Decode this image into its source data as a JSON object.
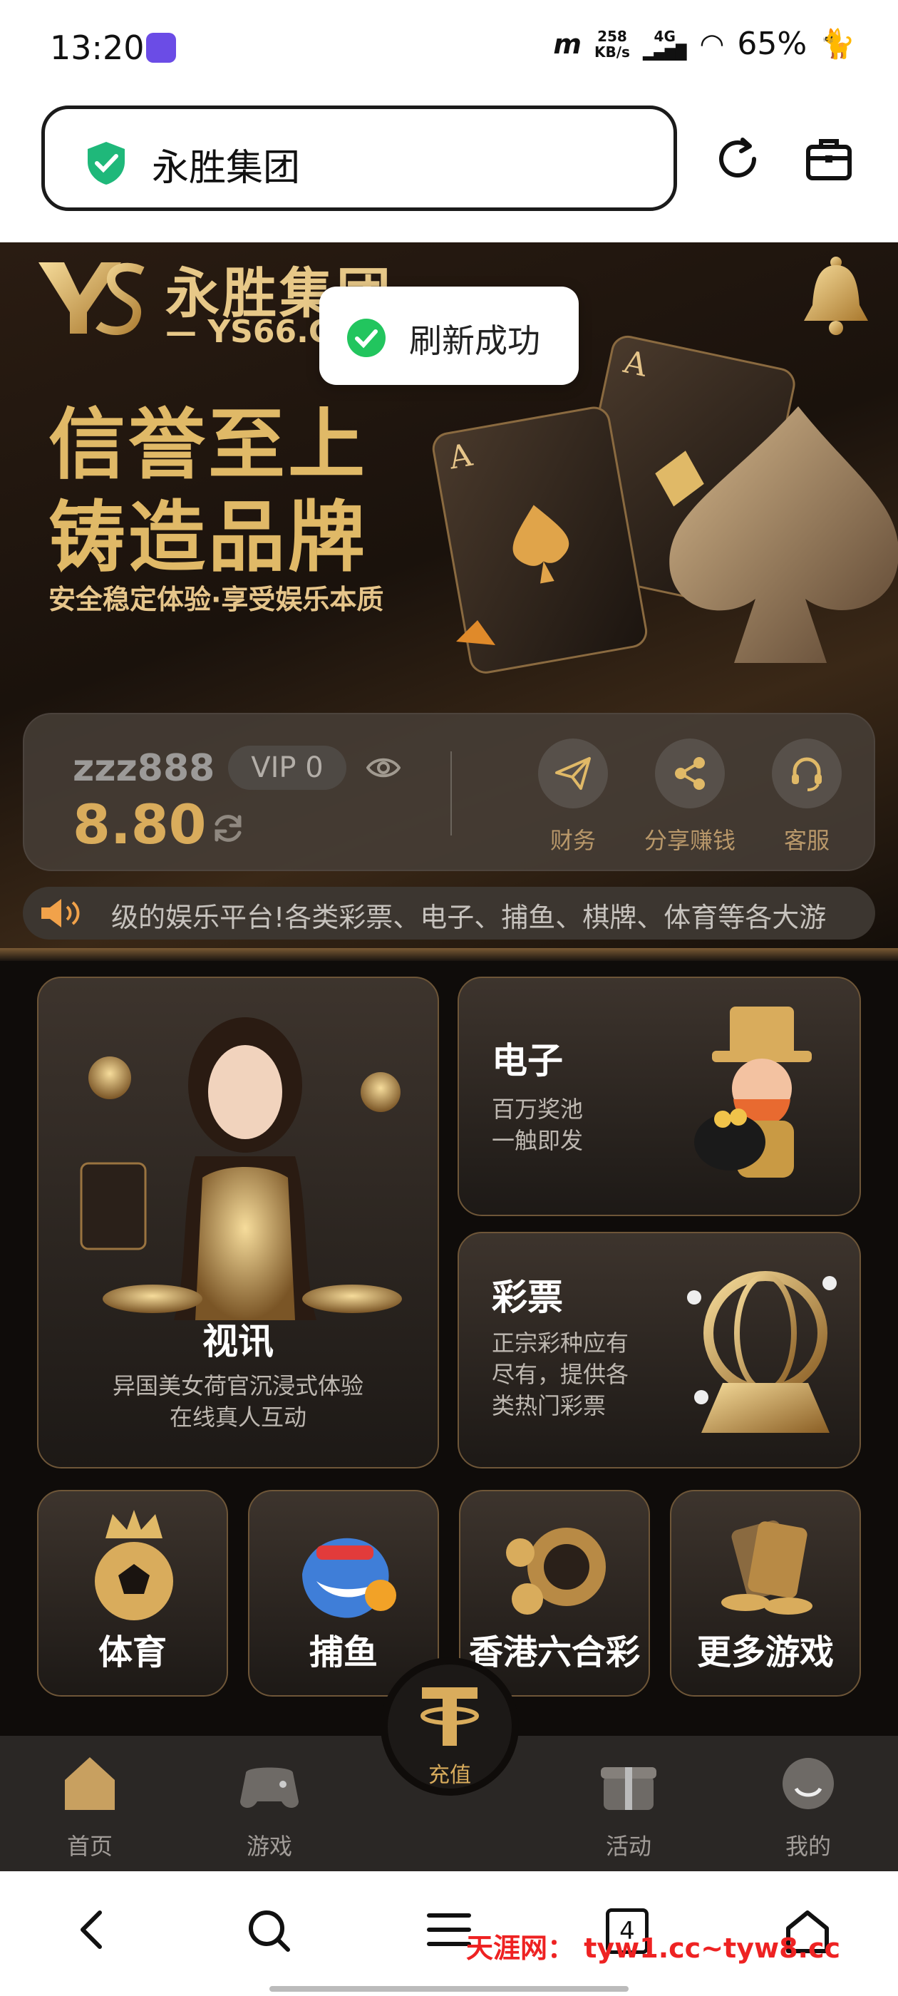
{
  "status_bar": {
    "time": "13:20",
    "speed_value": "258",
    "speed_unit": "KB/s",
    "network": "4G",
    "battery": "65%"
  },
  "browser": {
    "url_title": "永胜集团"
  },
  "banner": {
    "brand_name": "永胜集团",
    "brand_url": "— YS66.C",
    "slogan_line1": "信誉至上",
    "slogan_line2": "铸造品牌",
    "slogan_sub": "安全稳定体验·享受娱乐本质"
  },
  "toast": {
    "text": "刷新成功"
  },
  "account": {
    "username": "zzz888",
    "vip": "VIP 0",
    "balance": "8.80",
    "actions": [
      {
        "label": "财务",
        "icon": "paper-plane-icon"
      },
      {
        "label": "分享赚钱",
        "icon": "share-icon"
      },
      {
        "label": "客服",
        "icon": "headset-icon"
      }
    ]
  },
  "notice": {
    "text": "级的娱乐平台!各类彩票、电子、捕鱼、棋牌、体育等各大游"
  },
  "games": {
    "video": {
      "title": "视讯",
      "desc_line1": "异国美女荷官沉浸式体验",
      "desc_line2": "在线真人互动"
    },
    "slots": {
      "title": "电子",
      "desc_line1": "百万奖池",
      "desc_line2": "一触即发"
    },
    "lottery": {
      "title": "彩票",
      "desc_line1": "正宗彩种应有",
      "desc_line2": "尽有，提供各",
      "desc_line3": "类热门彩票"
    },
    "small": [
      {
        "label": "体育"
      },
      {
        "label": "捕鱼"
      },
      {
        "label": "香港六合彩"
      },
      {
        "label": "更多游戏"
      }
    ]
  },
  "tabbar": {
    "tabs": [
      {
        "label": "首页"
      },
      {
        "label": "游戏"
      },
      {
        "label": "活动"
      },
      {
        "label": "我的"
      }
    ],
    "center_label": "充值"
  },
  "system_nav": {
    "tabs_count": "4"
  },
  "watermark": {
    "text": "天涯网： tyw1.cc~tyw8.cc"
  },
  "colors": {
    "gold": "#d9ac5c",
    "dark_bg": "#0f0c0a",
    "toast_ok": "#22c55e",
    "shield": "#1fb87a"
  }
}
